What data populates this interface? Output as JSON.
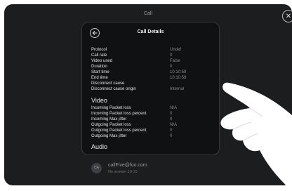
{
  "topbar": {
    "title": "Call"
  },
  "panel": {
    "title": "Call Details",
    "general_rows": [
      {
        "label": "Protocol",
        "value": "Undef"
      },
      {
        "label": "Call rate",
        "value": "0"
      },
      {
        "label": "Video used",
        "value": "False"
      },
      {
        "label": "Duration",
        "value": "0"
      },
      {
        "label": "Start time",
        "value": "10:10:59"
      },
      {
        "label": "End time",
        "value": "10:10:59"
      },
      {
        "label": "Disconnect cause",
        "value": ""
      },
      {
        "label": "Disconnect cause origin",
        "value": "Internal"
      }
    ],
    "video_heading": "Video",
    "video_rows": [
      {
        "label": "Incoming Packet loss",
        "value": "N/A"
      },
      {
        "label": "Incoming Packet loss percent",
        "value": "0"
      },
      {
        "label": "Incoming Max jitter",
        "value": "0"
      },
      {
        "label": "Outgoing Packet loss",
        "value": "N/A"
      },
      {
        "label": "Outgoing Packet loss percent",
        "value": "0"
      },
      {
        "label": "Outgoing Max jitter",
        "value": "0"
      }
    ],
    "audio_heading": "Audio"
  },
  "call_entry": {
    "avatar_initials": "CA",
    "name": "callFive@foo.com",
    "status": "No answer 10:10"
  },
  "icons": {
    "back": "arrow-left-icon",
    "close": "close-icon"
  }
}
